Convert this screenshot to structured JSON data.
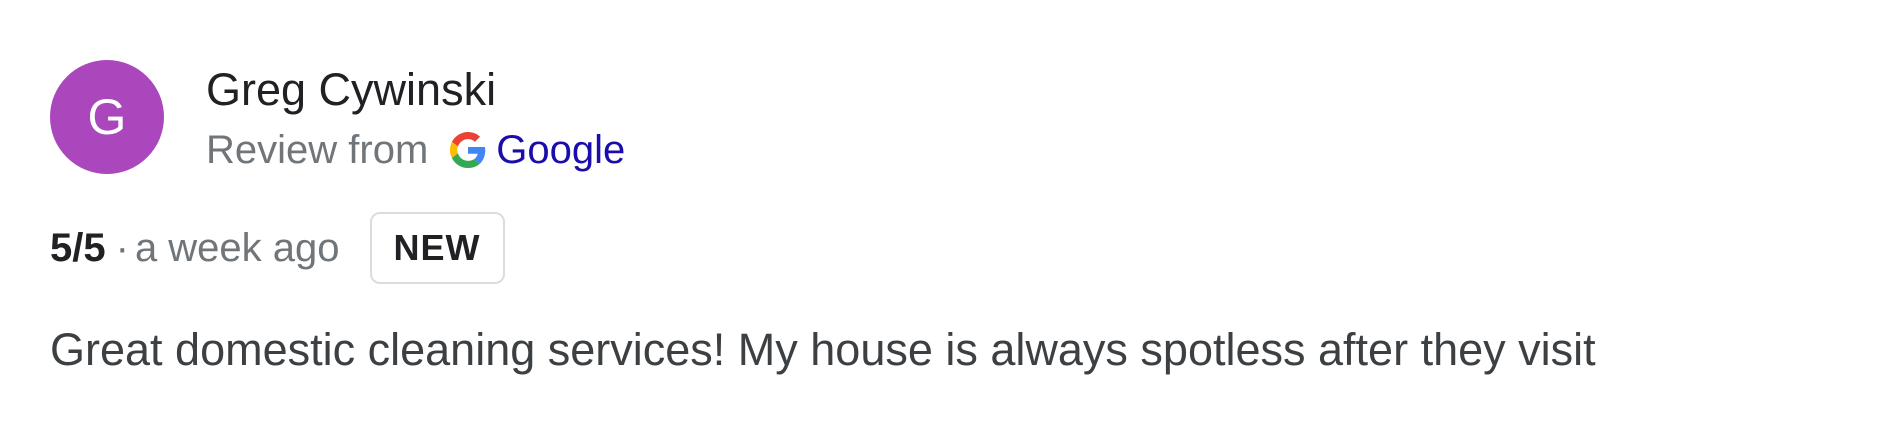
{
  "review": {
    "avatar": {
      "letter": "G",
      "color": "#ab47bc"
    },
    "reviewer_name": "Greg Cywinski",
    "source": {
      "prefix": "Review from",
      "icon": "google-g-icon",
      "name": "Google"
    },
    "rating": "5/5",
    "separator": "·",
    "time_ago": "a week ago",
    "badge": "NEW",
    "text": "Great domestic cleaning services! My house is always spotless after they visit"
  },
  "colors": {
    "link": "#1a0dab",
    "muted": "#70757a",
    "badge_border": "#dadce0"
  }
}
